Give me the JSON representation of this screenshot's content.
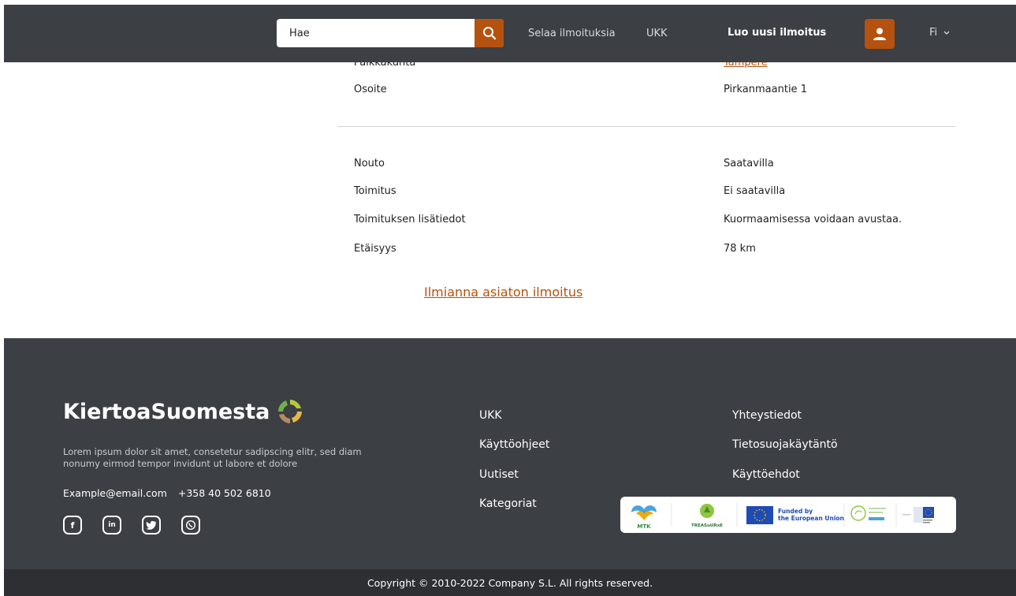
{
  "header": {
    "search_value": "Hae",
    "browse_label": "Selaa ilmoituksia",
    "faq_label": "UKK",
    "create_label": "Luo uusi ilmoitus",
    "language": "Fi"
  },
  "details": {
    "partial_label": "Paikkakunta",
    "partial_value": "Tampere",
    "address_label": "Osoite",
    "address_value": "Pirkanmaantie 1",
    "rows": [
      {
        "label": "Nouto",
        "value": "Saatavilla"
      },
      {
        "label": "Toimitus",
        "value": "Ei saatavilla"
      },
      {
        "label": "Toimituksen lisätiedot",
        "value": "Kuormaamisessa voidaan avustaa."
      },
      {
        "label": "Etäisyys",
        "value": "78 km"
      }
    ],
    "report_link": "Ilmianna asiaton ilmoitus"
  },
  "footer": {
    "brand": "KiertoaSuomesta",
    "description": "Lorem ipsum dolor sit amet, consetetur sadipscing elitr, sed diam nonumy eirmod tempor invidunt ut labore et dolore",
    "email": "Example@email.com",
    "phone": "+358 40 502 6810",
    "col1": [
      "UKK",
      "Käyttöohjeet",
      "Uutiset",
      "Kategoriat"
    ],
    "col2": [
      "Yhteystiedot",
      "Tietosuojakäytäntö",
      "Käyttöehdot"
    ],
    "logos": {
      "mtk": "MTK",
      "treasure": "TREASuURxE",
      "eu_line1": "Funded by",
      "eu_line2": "the European Union"
    },
    "copyright": "Copyright ©  2010-2022 Company S.L. All rights reserved."
  },
  "colors": {
    "accent": "#b5520f",
    "dark": "#3c3f44",
    "darker": "#2d2f33"
  }
}
